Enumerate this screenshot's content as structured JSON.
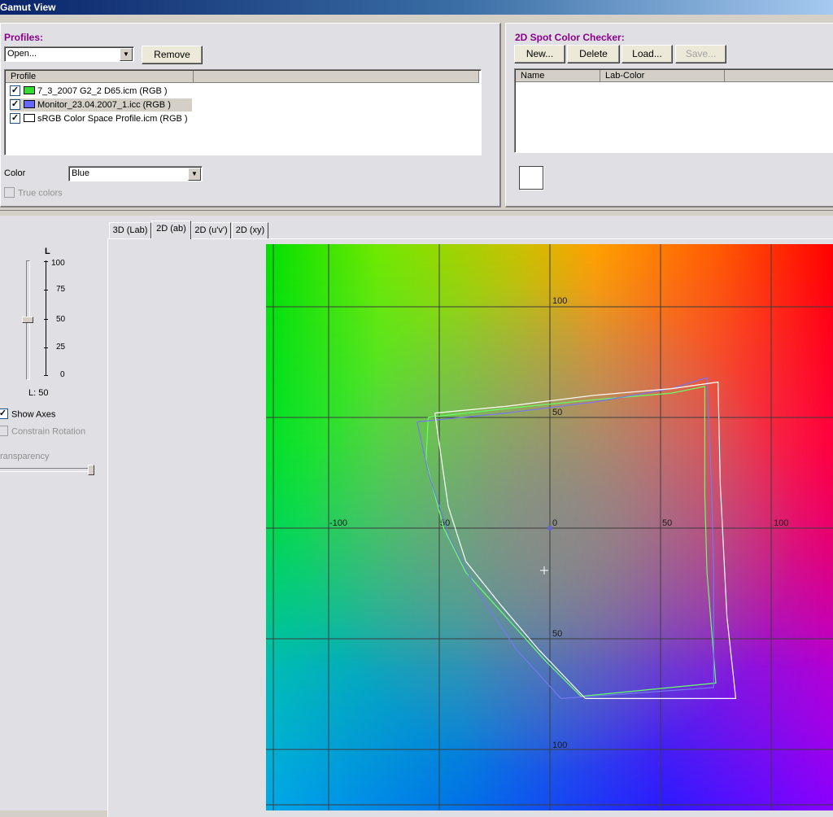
{
  "window": {
    "title": "Gamut View"
  },
  "profiles": {
    "title": "Profiles:",
    "open_combo": "Open...",
    "remove_button": "Remove",
    "column_header": "Profile",
    "items": [
      {
        "name": "7_3_2007 G2_2 D65.icm (RGB )",
        "checked": true,
        "color": "#33dd33",
        "selected": false
      },
      {
        "name": "Monitor_23.04.2007_1.icc (RGB )",
        "checked": true,
        "color": "#6666ff",
        "selected": true
      },
      {
        "name": "sRGB Color Space Profile.icm (RGB )",
        "checked": true,
        "color": "#ffffff",
        "selected": false
      }
    ],
    "color_label": "Color",
    "color_value": "Blue",
    "true_colors_label": "True colors",
    "true_colors_checked": false
  },
  "spot_checker": {
    "title": "2D Spot Color Checker:",
    "new_button": "New...",
    "delete_button": "Delete",
    "load_button": "Load...",
    "save_button": "Save...",
    "columns": [
      "Name",
      "Lab-Color"
    ],
    "swatch_color": "#ffffff"
  },
  "tabs": [
    "3D (Lab)",
    "2D (ab)",
    "2D (u'v')",
    "2D (xy)"
  ],
  "active_tab": "2D (ab)",
  "lightness": {
    "axis_title": "L",
    "ticks": [
      "100",
      "75",
      "50",
      "25",
      "0"
    ],
    "value": 50,
    "value_label": "L: 50"
  },
  "options": {
    "show_axes_label": "Show Axes",
    "show_axes_checked": true,
    "constrain_rotation_label": "Constrain Rotation",
    "constrain_rotation_checked": false,
    "transparency_label": "ransparency",
    "transparency_value": 1.0
  },
  "chart_data": {
    "type": "scatter",
    "a_range": [
      -128,
      128
    ],
    "b_range": [
      -128,
      128
    ],
    "grid": true,
    "axis_labels": {
      "a_axis": [
        "-100",
        "50",
        "0",
        "50",
        "100"
      ],
      "b_axis": [
        "100",
        "50",
        "50",
        "100"
      ]
    },
    "series": [
      {
        "name": "7_3_2007 G2_2 D65.icm (RGB )",
        "color": "#66ff66",
        "points": [
          [
            -55,
            50
          ],
          [
            -20,
            54
          ],
          [
            20,
            58
          ],
          [
            55,
            61
          ],
          [
            70,
            64
          ],
          [
            70,
            15
          ],
          [
            71,
            -20
          ],
          [
            75,
            -70
          ],
          [
            14,
            -76
          ],
          [
            -2,
            -60
          ],
          [
            -20,
            -40
          ],
          [
            -38,
            -20
          ],
          [
            -48,
            0
          ],
          [
            -56,
            30
          ],
          [
            -55,
            50
          ]
        ]
      },
      {
        "name": "Monitor_23.04.2007_1.icc (RGB )",
        "color": "#7777ee",
        "points": [
          [
            -60,
            48
          ],
          [
            -20,
            52
          ],
          [
            20,
            57
          ],
          [
            55,
            63
          ],
          [
            71,
            68
          ],
          [
            73,
            20
          ],
          [
            74,
            -20
          ],
          [
            74,
            -72
          ],
          [
            5,
            -77
          ],
          [
            -15,
            -55
          ],
          [
            -32,
            -30
          ],
          [
            -45,
            -5
          ],
          [
            -55,
            25
          ],
          [
            -60,
            48
          ]
        ]
      },
      {
        "name": "sRGB Color Space Profile.icm (RGB )",
        "color": "#ffffff",
        "points": [
          [
            -52,
            52
          ],
          [
            -20,
            55
          ],
          [
            20,
            60
          ],
          [
            55,
            63
          ],
          [
            76,
            66
          ],
          [
            77,
            20
          ],
          [
            80,
            -40
          ],
          [
            84,
            -77
          ],
          [
            16,
            -77
          ],
          [
            -5,
            -55
          ],
          [
            -22,
            -35
          ],
          [
            -38,
            -15
          ],
          [
            -46,
            10
          ],
          [
            -52,
            52
          ]
        ]
      }
    ]
  }
}
